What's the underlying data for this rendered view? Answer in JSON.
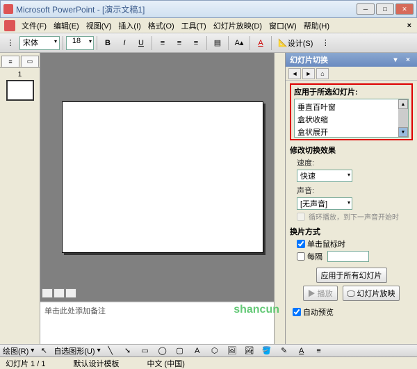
{
  "title": "Microsoft PowerPoint - [演示文稿1]",
  "menu": [
    "文件(F)",
    "编辑(E)",
    "视图(V)",
    "插入(I)",
    "格式(O)",
    "工具(T)",
    "幻灯片放映(D)",
    "窗口(W)",
    "帮助(H)"
  ],
  "toolbar": {
    "font": "宋体",
    "size": "18",
    "design": "设计(S)"
  },
  "thumb": {
    "num": "1"
  },
  "notes": {
    "placeholder": "单击此处添加备注"
  },
  "taskpane": {
    "title": "幻灯片切换",
    "section1": "应用于所选幻灯片:",
    "list": [
      "垂直百叶窗",
      "盒状收缩",
      "盒状展开"
    ],
    "section2": "修改切换效果",
    "speed_label": "速度:",
    "speed": "快速",
    "sound_label": "声音:",
    "sound": "[无声音]",
    "loop": "循环播放，到下一声音开始时",
    "section3": "换片方式",
    "onclick": "单击鼠标时",
    "every": "每隔",
    "applyall": "应用于所有幻灯片",
    "play": "播放",
    "slideshow": "幻灯片放映",
    "autopreview": "自动预览"
  },
  "drawbar": {
    "draw": "绘图(R)",
    "autoshape": "自选图形(U)"
  },
  "status": {
    "slide": "幻灯片 1 / 1",
    "template": "默认设计模板",
    "lang": "中文 (中国)"
  },
  "watermark": "shancun"
}
